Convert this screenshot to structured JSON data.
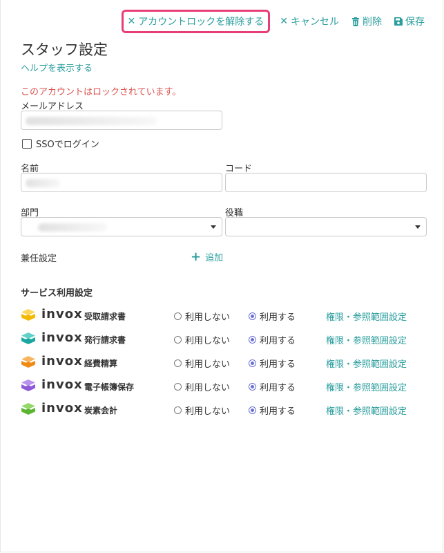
{
  "toolbar": {
    "unlock_label": "アカウントロックを解除する",
    "cancel_label": "キャンセル",
    "delete_label": "削除",
    "save_label": "保存"
  },
  "page": {
    "title": "スタッフ設定",
    "help_label": "ヘルプを表示する",
    "lock_message": "このアカウントはロックされています。"
  },
  "form": {
    "email_label": "メールアドレス",
    "sso_label": "SSOでログイン",
    "name_label": "名前",
    "code_label": "コード",
    "department_label": "部門",
    "position_label": "役職",
    "concurrent_label": "兼任設定",
    "add_label": "追加"
  },
  "services": {
    "section_title": "サービス利用設定",
    "brand": "invox",
    "off_label": "利用しない",
    "on_label": "利用する",
    "perm_label": "権限・参照範囲設定",
    "items": [
      {
        "name": "受取請求書",
        "color": "#f5b800",
        "color2": "#fcd75a"
      },
      {
        "name": "発行請求書",
        "color": "#1aa7a0",
        "color2": "#5fd1c9"
      },
      {
        "name": "経費精算",
        "color": "#f18a14",
        "color2": "#f8b45e"
      },
      {
        "name": "電子帳簿保存",
        "color": "#8e5ad6",
        "color2": "#b892ec"
      },
      {
        "name": "炭素会計",
        "color": "#5cb531",
        "color2": "#93d86a"
      }
    ]
  },
  "colors": {
    "accent": "#2a9d9d",
    "error": "#d9534f",
    "highlight": "#e83e76",
    "radio": "#6a6fd6"
  }
}
